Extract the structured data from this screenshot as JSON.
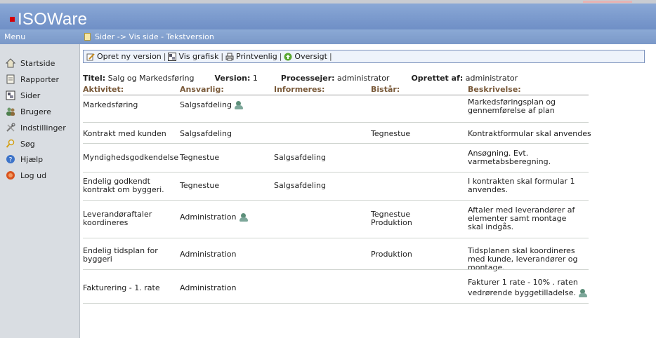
{
  "app": {
    "name": "ISOWare"
  },
  "menu_label": "Menu",
  "breadcrumb": "Sider -> Vis side - Tekstversion",
  "sidebar": {
    "items": [
      {
        "label": "Startside",
        "icon": "home-icon"
      },
      {
        "label": "Rapporter",
        "icon": "report-icon"
      },
      {
        "label": "Sider",
        "icon": "pages-icon"
      },
      {
        "label": "Brugere",
        "icon": "users-icon"
      },
      {
        "label": "Indstillinger",
        "icon": "tools-icon"
      },
      {
        "label": "Søg",
        "icon": "search-icon"
      },
      {
        "label": "Hjælp",
        "icon": "help-icon"
      },
      {
        "label": "Log ud",
        "icon": "logout-icon"
      }
    ]
  },
  "toolbar": {
    "new_version": "Opret ny version",
    "graphic": "Vis grafisk",
    "print": "Printvenlig",
    "overview": "Oversigt"
  },
  "meta": {
    "title_label": "Titel:",
    "title_value": "Salg og Markedsføring",
    "version_label": "Version:",
    "version_value": "1",
    "owner_label": "Processejer:",
    "owner_value": "administrator",
    "created_label": "Oprettet af:",
    "created_value": "administrator"
  },
  "table": {
    "headers": [
      "Aktivitet:",
      "Ansvarlig:",
      "Informeres:",
      "Bistår:",
      "Beskrivelse:"
    ],
    "rows": [
      {
        "activity": "Markedsføring",
        "responsible": "Salgsafdeling",
        "inform": "",
        "assist": "",
        "description": "Markedsføringsplan og gennemførelse af plan"
      },
      {
        "activity": "Kontrakt med kunden",
        "responsible": "Salgsafdeling",
        "inform": "",
        "assist": "Tegnestue",
        "description": "Kontraktformular skal anvendes"
      },
      {
        "activity": "Myndighedsgodkendelse",
        "responsible": "Tegnestue",
        "inform": "Salgsafdeling",
        "assist": "",
        "description": "Ansøgning. Evt. varmetabsberegning."
      },
      {
        "activity": "Endelig godkendt kontrakt om byggeri.",
        "responsible": "Tegnestue",
        "inform": "Salgsafdeling",
        "assist": "",
        "description": "I kontrakten skal formular 1 anvendes."
      },
      {
        "activity": "Leverandøraftaler koordineres",
        "responsible": "Administration",
        "inform": "",
        "assist": "Tegnestue Produktion",
        "description": "Aftaler med leverandører af elementer samt montage skal indgås."
      },
      {
        "activity": "Endelig tidsplan for byggeri",
        "responsible": "Administration",
        "inform": "",
        "assist": "Produktion",
        "description": "Tidsplanen skal koordineres med kunde, leverandører og montage."
      },
      {
        "activity": "Fakturering - 1. rate",
        "responsible": "Administration",
        "inform": "",
        "assist": "",
        "description": "Fakturer 1 rate - 10% . raten vedrørende byggetilladelse."
      }
    ]
  },
  "colors": {
    "header_blue": "#7a98c8",
    "sidebar_bg": "#d9dde2",
    "header_text": "#7a5a3a",
    "link_blue": "#1b3a9c",
    "logo_red": "#d4000a"
  }
}
